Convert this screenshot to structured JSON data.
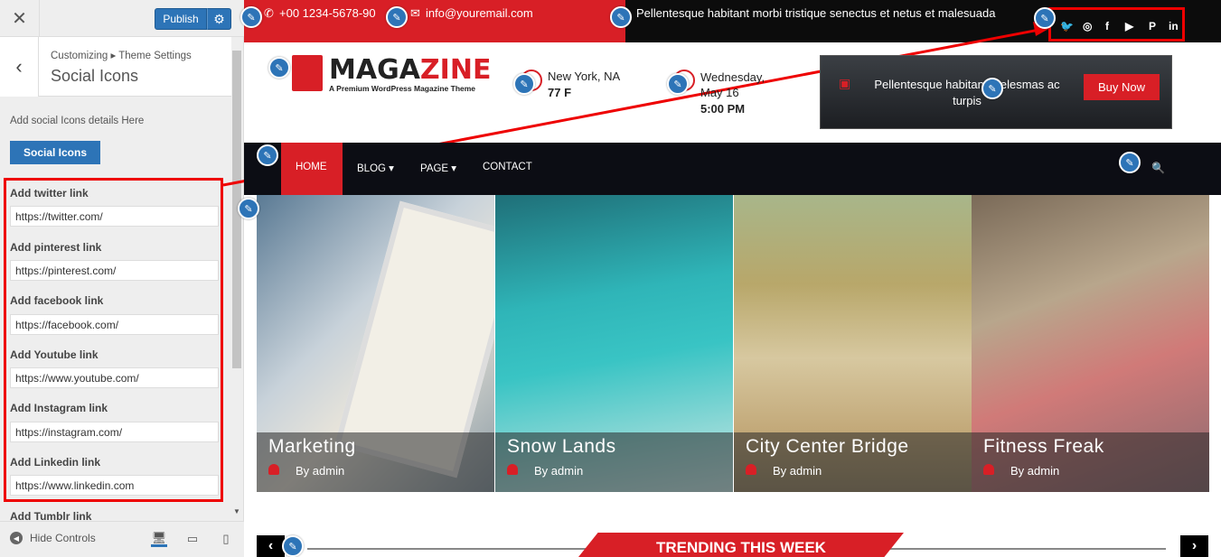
{
  "customizer": {
    "close_icon": "close-icon",
    "publish_label": "Publish",
    "breadcrumb": "Customizing ▸ Theme Settings",
    "section_title": "Social Icons",
    "description": "Add social Icons details Here",
    "section_button": "Social Icons",
    "fields": [
      {
        "label": "Add twitter link",
        "value": "https://twitter.com/"
      },
      {
        "label": "Add pinterest link",
        "value": "https://pinterest.com/"
      },
      {
        "label": "Add facebook link",
        "value": "https://facebook.com/"
      },
      {
        "label": "Add Youtube link",
        "value": "https://www.youtube.com/"
      },
      {
        "label": "Add Instagram link",
        "value": "https://instagram.com/"
      },
      {
        "label": "Add Linkedin link",
        "value": "https://www.linkedin.com"
      },
      {
        "label": "Add Tumblr link",
        "value": ""
      }
    ],
    "hide_controls": "Hide Controls"
  },
  "site": {
    "phone": "+00 1234-5678-90",
    "email": "info@youremail.com",
    "tagline": "Pellentesque habitant morbi tristique senectus et netus et malesuada",
    "social": [
      "twitter",
      "instagram",
      "facebook",
      "youtube",
      "pinterest",
      "linkedin"
    ],
    "logo_a": "MAGA",
    "logo_b": "ZINE",
    "logo_sub": "A Premium WordPress Magazine Theme",
    "location": "New York, NA",
    "temp": "77 F",
    "date": "Wednesday, May 16",
    "time": "5:00 PM",
    "banner_text": "Pellentesque habitant melesmas ac turpis",
    "buy_now": "Buy Now",
    "nav": [
      "HOME",
      "BLOG",
      "PAGE",
      "CONTACT"
    ],
    "posts": [
      {
        "title": "Marketing",
        "author": "By admin"
      },
      {
        "title": "Snow Lands",
        "author": "By admin"
      },
      {
        "title": "City Center Bridge",
        "author": "By admin"
      },
      {
        "title": "Fitness Freak",
        "author": "By admin"
      }
    ],
    "trending": "TRENDING THIS WEEK"
  },
  "colors": {
    "accent": "#d81f26",
    "wp_blue": "#2d74b7",
    "dark": "#0c0d14"
  }
}
